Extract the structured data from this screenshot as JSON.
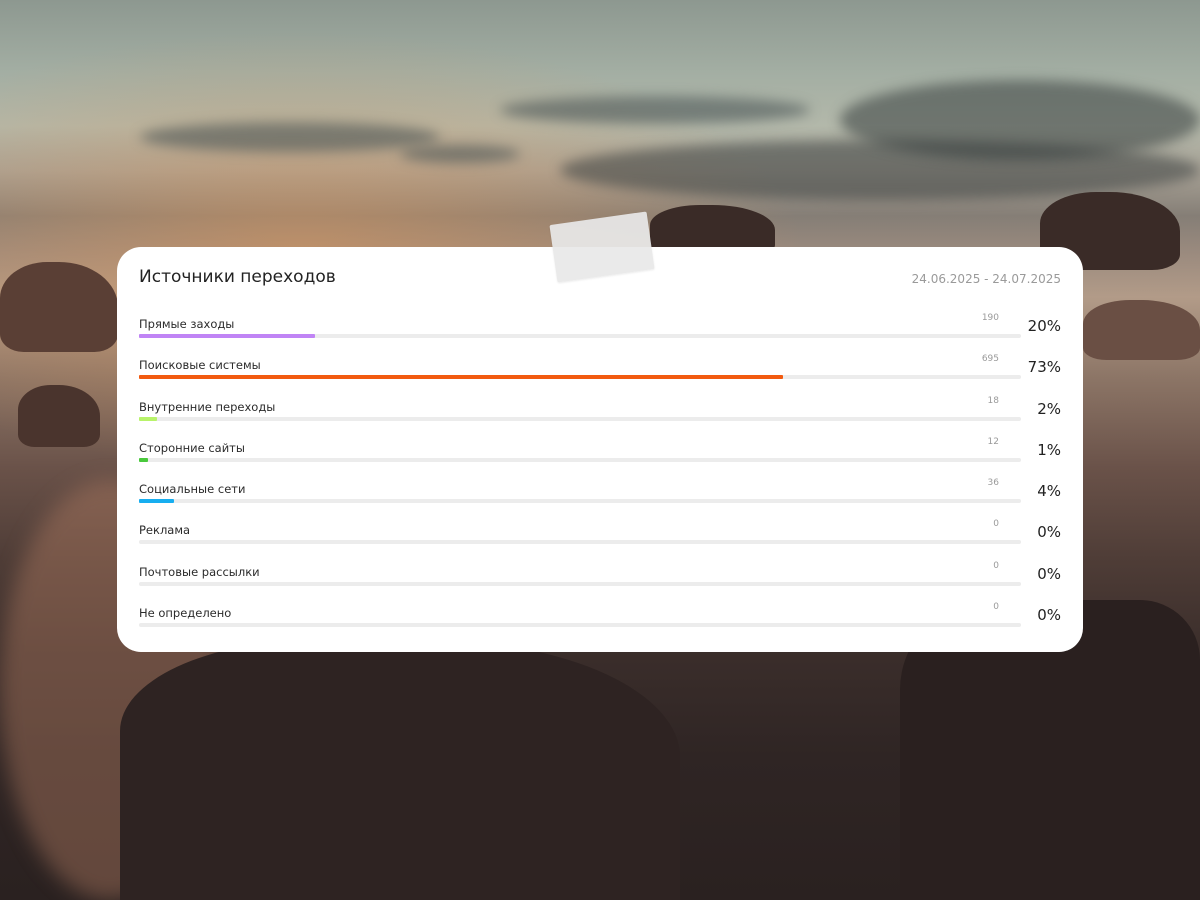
{
  "widget": {
    "title": "Источники переходов",
    "period": "24.06.2025 - 24.07.2025"
  },
  "sources": [
    {
      "label": "Прямые заходы",
      "count": "190",
      "percent": "20%",
      "fraction": 0.2,
      "color": "#c084f5"
    },
    {
      "label": "Поисковые системы",
      "count": "695",
      "percent": "73%",
      "fraction": 0.73,
      "color": "#f25a0f"
    },
    {
      "label": "Внутренние переходы",
      "count": "18",
      "percent": "2%",
      "fraction": 0.02,
      "color": "#b8f36a"
    },
    {
      "label": "Сторонние сайты",
      "count": "12",
      "percent": "1%",
      "fraction": 0.01,
      "color": "#49c93c"
    },
    {
      "label": "Социальные сети",
      "count": "36",
      "percent": "4%",
      "fraction": 0.04,
      "color": "#17aef0"
    },
    {
      "label": "Реклама",
      "count": "0",
      "percent": "0%",
      "fraction": 0,
      "color": "#cccccc"
    },
    {
      "label": "Почтовые рассылки",
      "count": "0",
      "percent": "0%",
      "fraction": 0,
      "color": "#cccccc"
    },
    {
      "label": "Не определено",
      "count": "0",
      "percent": "0%",
      "fraction": 0,
      "color": "#cccccc"
    }
  ]
}
